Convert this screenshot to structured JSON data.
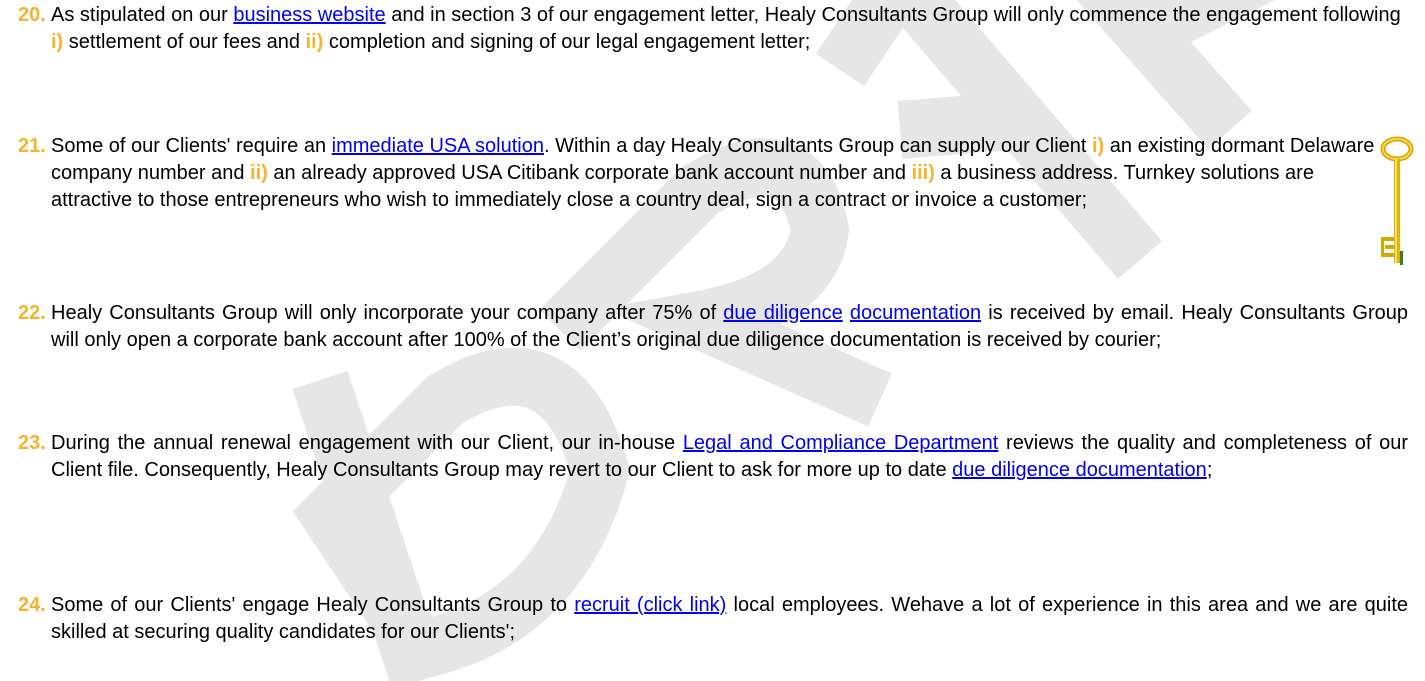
{
  "colors": {
    "accent": "#f5b32e",
    "link": "#0000ee",
    "text": "#000000",
    "watermark": "#e6e6e6"
  },
  "watermark": {
    "text": "DRAFT"
  },
  "items": [
    {
      "number": "20.",
      "t1": "As stipulated on our ",
      "link1": "business website",
      "t2": " and in section 3 of our engagement letter, Healy Consultants Group will only commence the engagement following ",
      "m1": "i)",
      "t3": " settlement of our fees and ",
      "m2": "ii)",
      "t4": " completion and signing of our legal engagement letter;"
    },
    {
      "number": "21.",
      "t1": "Some of our Clients' require an ",
      "link1": "immediate USA solution",
      "t2": ". Within a day Healy Consultants Group can supply our Client ",
      "m1": "i)",
      "t3": " an existing dormant Delaware company number and ",
      "m2": "ii)",
      "t4": " an already approved USA Citibank corporate bank account number and ",
      "m3": "iii)",
      "t5": " a business address. Turnkey solutions are attractive to those entrepreneurs who wish to immediately close a country deal, sign a contract or invoice a customer;",
      "icon": "gold-key-icon"
    },
    {
      "number": "22.",
      "t1": "Healy Consultants Group will only incorporate your company after 75% of ",
      "link1": "due diligence",
      "t2": " ",
      "link2": "documentation",
      "t3": " is received by email. Healy Consultants Group will only open a corporate bank account after 100% of the Client’s original due diligence documentation is received by courier;"
    },
    {
      "number": "23.",
      "t1": "During the annual renewal engagement with our Client, our in-house ",
      "link1": "Legal and Compliance Department",
      "t2": " reviews the quality and completeness of our Client file. Consequently, Healy Consultants Group may revert to our Client to ask for more up to date ",
      "link2": "due diligence documentation",
      "t3": ";"
    },
    {
      "number": "24.",
      "t1": "Some of our Clients' engage Healy Consultants Group to ",
      "link1": "recruit (click link)",
      "t2": " local employees. Wehave a lot of experience in this area and we are quite skilled at securing quality candidates for our Clients';"
    }
  ]
}
